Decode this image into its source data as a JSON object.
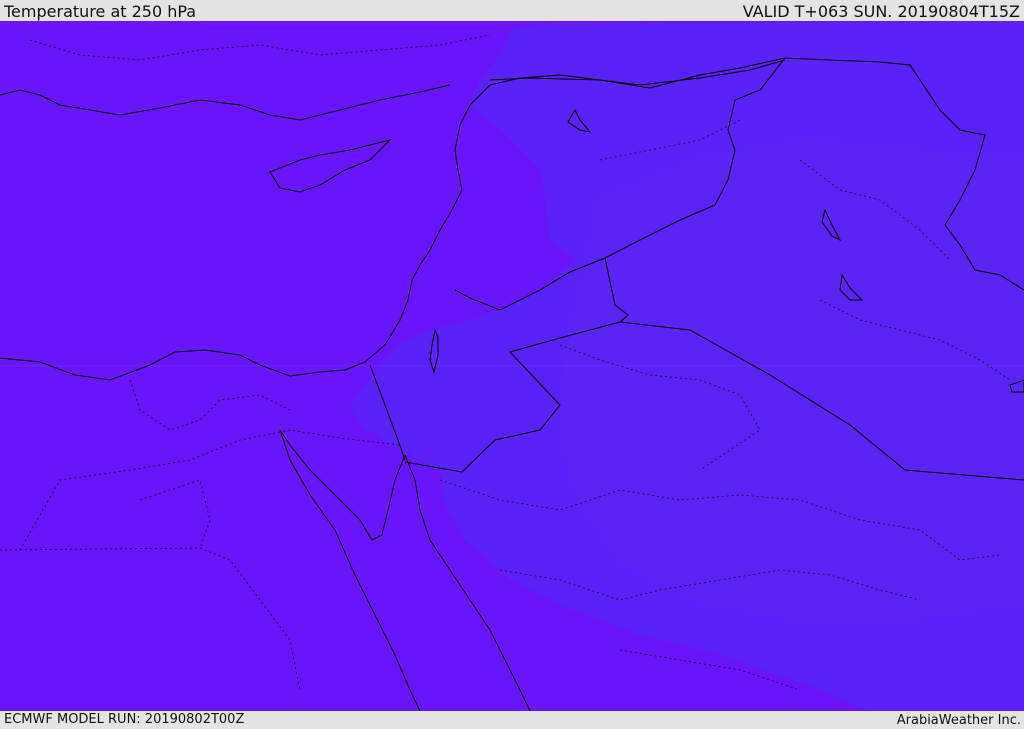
{
  "header": {
    "title": "Temperature at 250 hPa",
    "valid": "VALID T+063 SUN. 20190804T15Z"
  },
  "footer": {
    "model_run": "ECMWF MODEL RUN: 20190802T00Z",
    "credit": "ArabiaWeather Inc."
  },
  "map": {
    "colors": {
      "warm_band": "#6a14fa",
      "mid_band": "#5a22f6",
      "cool_band": "#5a2af2",
      "borders": "#000000"
    }
  }
}
